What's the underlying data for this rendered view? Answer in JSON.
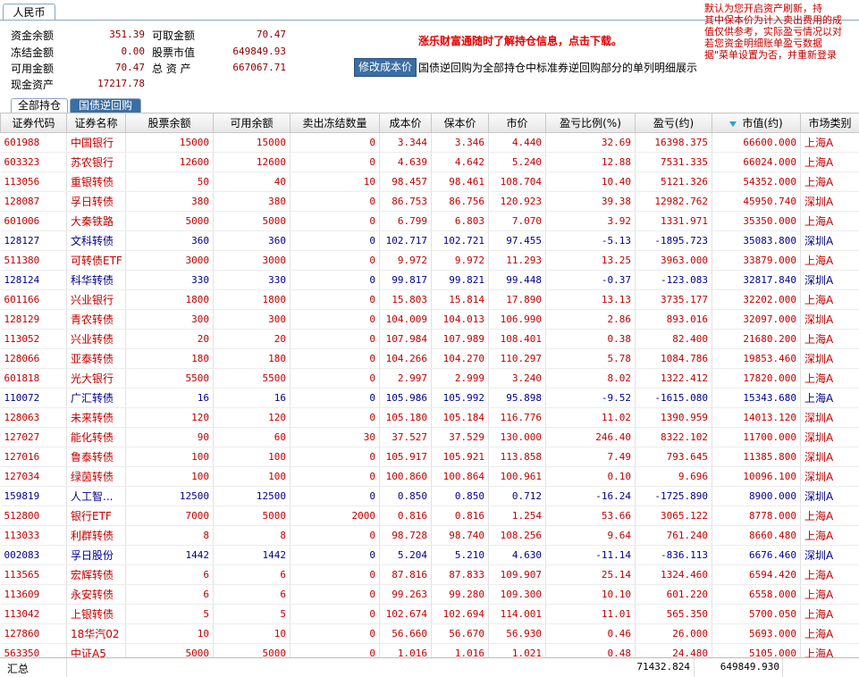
{
  "currency_tab": "人民币",
  "summary": {
    "cash_balance_label": "资金余额",
    "cash_balance": "351.39",
    "withdrawable_label": "可取金额",
    "withdrawable": "70.47",
    "frozen_label": "冻结金额",
    "frozen": "0.00",
    "stock_value_label": "股票市值",
    "stock_value": "649849.93",
    "available_label": "可用金额",
    "available": "70.47",
    "total_assets_label": "总 资 产",
    "total_assets": "667067.71",
    "cash_assets_label": "现金资产",
    "cash_assets": "17217.78"
  },
  "promo_text": "涨乐财富通随时了解持仓信息，点击下载。",
  "edit_cost_button": "修改成本价",
  "repo_note": "国债逆回购为全部持仓中标准券逆回购部分的单列明细展示",
  "right_note": [
    "      默认为您开启资产刷新，持",
    "其中保本价为计入卖出费用的成",
    "值仅供参考，实际盈亏情况以对",
    "      若您资金明细账单盈亏数据",
    "据\"菜单设置为否，并重新登录"
  ],
  "subtabs": {
    "all": "全部持仓",
    "repo": "国债逆回购"
  },
  "columns": [
    "证券代码",
    "证券名称",
    "股票余额",
    "可用余额",
    "卖出冻结数量",
    "成本价",
    "保本价",
    "市价",
    "盈亏比例(%)",
    "盈亏(约)",
    "市值(约)",
    "市场类别"
  ],
  "rows": [
    {
      "code": "601988",
      "name": "中国银行",
      "bal": "15000",
      "avail": "15000",
      "frz": "0",
      "cost": "3.344",
      "be": "3.346",
      "px": "4.440",
      "pct": "32.69",
      "pnl": "16398.375",
      "mv": "66600.000",
      "mkt": "上海A",
      "color": "red"
    },
    {
      "code": "603323",
      "name": "苏农银行",
      "bal": "12600",
      "avail": "12600",
      "frz": "0",
      "cost": "4.639",
      "be": "4.642",
      "px": "5.240",
      "pct": "12.88",
      "pnl": "7531.335",
      "mv": "66024.000",
      "mkt": "上海A",
      "color": "red"
    },
    {
      "code": "113056",
      "name": "重银转债",
      "bal": "50",
      "avail": "40",
      "frz": "10",
      "cost": "98.457",
      "be": "98.461",
      "px": "108.704",
      "pct": "10.40",
      "pnl": "5121.326",
      "mv": "54352.000",
      "mkt": "上海A",
      "color": "red"
    },
    {
      "code": "128087",
      "name": "孚日转债",
      "bal": "380",
      "avail": "380",
      "frz": "0",
      "cost": "86.753",
      "be": "86.756",
      "px": "120.923",
      "pct": "39.38",
      "pnl": "12982.762",
      "mv": "45950.740",
      "mkt": "深圳A",
      "color": "red"
    },
    {
      "code": "601006",
      "name": "大秦铁路",
      "bal": "5000",
      "avail": "5000",
      "frz": "0",
      "cost": "6.799",
      "be": "6.803",
      "px": "7.070",
      "pct": "3.92",
      "pnl": "1331.971",
      "mv": "35350.000",
      "mkt": "上海A",
      "color": "red"
    },
    {
      "code": "128127",
      "name": "文科转债",
      "bal": "360",
      "avail": "360",
      "frz": "0",
      "cost": "102.717",
      "be": "102.721",
      "px": "97.455",
      "pct": "-5.13",
      "pnl": "-1895.723",
      "mv": "35083.800",
      "mkt": "深圳A",
      "color": "blue"
    },
    {
      "code": "511380",
      "name": "可转债ETF",
      "bal": "3000",
      "avail": "3000",
      "frz": "0",
      "cost": "9.972",
      "be": "9.972",
      "px": "11.293",
      "pct": "13.25",
      "pnl": "3963.000",
      "mv": "33879.000",
      "mkt": "上海A",
      "color": "red"
    },
    {
      "code": "128124",
      "name": "科华转债",
      "bal": "330",
      "avail": "330",
      "frz": "0",
      "cost": "99.817",
      "be": "99.821",
      "px": "99.448",
      "pct": "-0.37",
      "pnl": "-123.083",
      "mv": "32817.840",
      "mkt": "深圳A",
      "color": "blue"
    },
    {
      "code": "601166",
      "name": "兴业银行",
      "bal": "1800",
      "avail": "1800",
      "frz": "0",
      "cost": "15.803",
      "be": "15.814",
      "px": "17.890",
      "pct": "13.13",
      "pnl": "3735.177",
      "mv": "32202.000",
      "mkt": "上海A",
      "color": "red"
    },
    {
      "code": "128129",
      "name": "青农转债",
      "bal": "300",
      "avail": "300",
      "frz": "0",
      "cost": "104.009",
      "be": "104.013",
      "px": "106.990",
      "pct": "2.86",
      "pnl": "893.016",
      "mv": "32097.000",
      "mkt": "深圳A",
      "color": "red"
    },
    {
      "code": "113052",
      "name": "兴业转债",
      "bal": "20",
      "avail": "20",
      "frz": "0",
      "cost": "107.984",
      "be": "107.989",
      "px": "108.401",
      "pct": "0.38",
      "pnl": "82.400",
      "mv": "21680.200",
      "mkt": "上海A",
      "color": "red"
    },
    {
      "code": "128066",
      "name": "亚泰转债",
      "bal": "180",
      "avail": "180",
      "frz": "0",
      "cost": "104.266",
      "be": "104.270",
      "px": "110.297",
      "pct": "5.78",
      "pnl": "1084.786",
      "mv": "19853.460",
      "mkt": "深圳A",
      "color": "red"
    },
    {
      "code": "601818",
      "name": "光大银行",
      "bal": "5500",
      "avail": "5500",
      "frz": "0",
      "cost": "2.997",
      "be": "2.999",
      "px": "3.240",
      "pct": "8.02",
      "pnl": "1322.412",
      "mv": "17820.000",
      "mkt": "上海A",
      "color": "red"
    },
    {
      "code": "110072",
      "name": "广汇转债",
      "bal": "16",
      "avail": "16",
      "frz": "0",
      "cost": "105.986",
      "be": "105.992",
      "px": "95.898",
      "pct": "-9.52",
      "pnl": "-1615.080",
      "mv": "15343.680",
      "mkt": "上海A",
      "color": "blue"
    },
    {
      "code": "128063",
      "name": "未来转债",
      "bal": "120",
      "avail": "120",
      "frz": "0",
      "cost": "105.180",
      "be": "105.184",
      "px": "116.776",
      "pct": "11.02",
      "pnl": "1390.959",
      "mv": "14013.120",
      "mkt": "深圳A",
      "color": "red"
    },
    {
      "code": "127027",
      "name": "能化转债",
      "bal": "90",
      "avail": "60",
      "frz": "30",
      "cost": "37.527",
      "be": "37.529",
      "px": "130.000",
      "pct": "246.40",
      "pnl": "8322.102",
      "mv": "11700.000",
      "mkt": "深圳A",
      "color": "red"
    },
    {
      "code": "127016",
      "name": "鲁泰转债",
      "bal": "100",
      "avail": "100",
      "frz": "0",
      "cost": "105.917",
      "be": "105.921",
      "px": "113.858",
      "pct": "7.49",
      "pnl": "793.645",
      "mv": "11385.800",
      "mkt": "深圳A",
      "color": "red"
    },
    {
      "code": "127034",
      "name": "绿茵转债",
      "bal": "100",
      "avail": "100",
      "frz": "0",
      "cost": "100.860",
      "be": "100.864",
      "px": "100.961",
      "pct": "0.10",
      "pnl": "9.696",
      "mv": "10096.100",
      "mkt": "深圳A",
      "color": "red"
    },
    {
      "code": "159819",
      "name": "人工智...",
      "bal": "12500",
      "avail": "12500",
      "frz": "0",
      "cost": "0.850",
      "be": "0.850",
      "px": "0.712",
      "pct": "-16.24",
      "pnl": "-1725.890",
      "mv": "8900.000",
      "mkt": "深圳A",
      "color": "blue"
    },
    {
      "code": "512800",
      "name": "银行ETF",
      "bal": "7000",
      "avail": "5000",
      "frz": "2000",
      "cost": "0.816",
      "be": "0.816",
      "px": "1.254",
      "pct": "53.66",
      "pnl": "3065.122",
      "mv": "8778.000",
      "mkt": "上海A",
      "color": "red"
    },
    {
      "code": "113033",
      "name": "利群转债",
      "bal": "8",
      "avail": "8",
      "frz": "0",
      "cost": "98.728",
      "be": "98.740",
      "px": "108.256",
      "pct": "9.64",
      "pnl": "761.240",
      "mv": "8660.480",
      "mkt": "上海A",
      "color": "red"
    },
    {
      "code": "002083",
      "name": "孚日股份",
      "bal": "1442",
      "avail": "1442",
      "frz": "0",
      "cost": "5.204",
      "be": "5.210",
      "px": "4.630",
      "pct": "-11.14",
      "pnl": "-836.113",
      "mv": "6676.460",
      "mkt": "深圳A",
      "color": "blue"
    },
    {
      "code": "113565",
      "name": "宏辉转债",
      "bal": "6",
      "avail": "6",
      "frz": "0",
      "cost": "87.816",
      "be": "87.833",
      "px": "109.907",
      "pct": "25.14",
      "pnl": "1324.460",
      "mv": "6594.420",
      "mkt": "上海A",
      "color": "red"
    },
    {
      "code": "113609",
      "name": "永安转债",
      "bal": "6",
      "avail": "6",
      "frz": "0",
      "cost": "99.263",
      "be": "99.280",
      "px": "109.300",
      "pct": "10.10",
      "pnl": "601.220",
      "mv": "6558.000",
      "mkt": "上海A",
      "color": "red"
    },
    {
      "code": "113042",
      "name": "上银转债",
      "bal": "5",
      "avail": "5",
      "frz": "0",
      "cost": "102.674",
      "be": "102.694",
      "px": "114.001",
      "pct": "11.01",
      "pnl": "565.350",
      "mv": "5700.050",
      "mkt": "上海A",
      "color": "red"
    },
    {
      "code": "127860",
      "name": "18华汽02",
      "bal": "10",
      "avail": "10",
      "frz": "0",
      "cost": "56.660",
      "be": "56.670",
      "px": "56.930",
      "pct": "0.46",
      "pnl": "26.000",
      "mv": "5693.000",
      "mkt": "上海A",
      "color": "red"
    },
    {
      "code": "563350",
      "name": "中证A5",
      "bal": "5000",
      "avail": "5000",
      "frz": "0",
      "cost": "1.016",
      "be": "1.016",
      "px": "1.021",
      "pct": "0.48",
      "pnl": "24.480",
      "mv": "5105.000",
      "mkt": "上海A",
      "color": "red"
    }
  ],
  "totals": {
    "label": "汇总",
    "pnl": "71432.824",
    "mv": "649849.930"
  },
  "colors": {
    "profit": "#c00000",
    "loss": "#00008b",
    "accent": "#3a6ea5"
  }
}
